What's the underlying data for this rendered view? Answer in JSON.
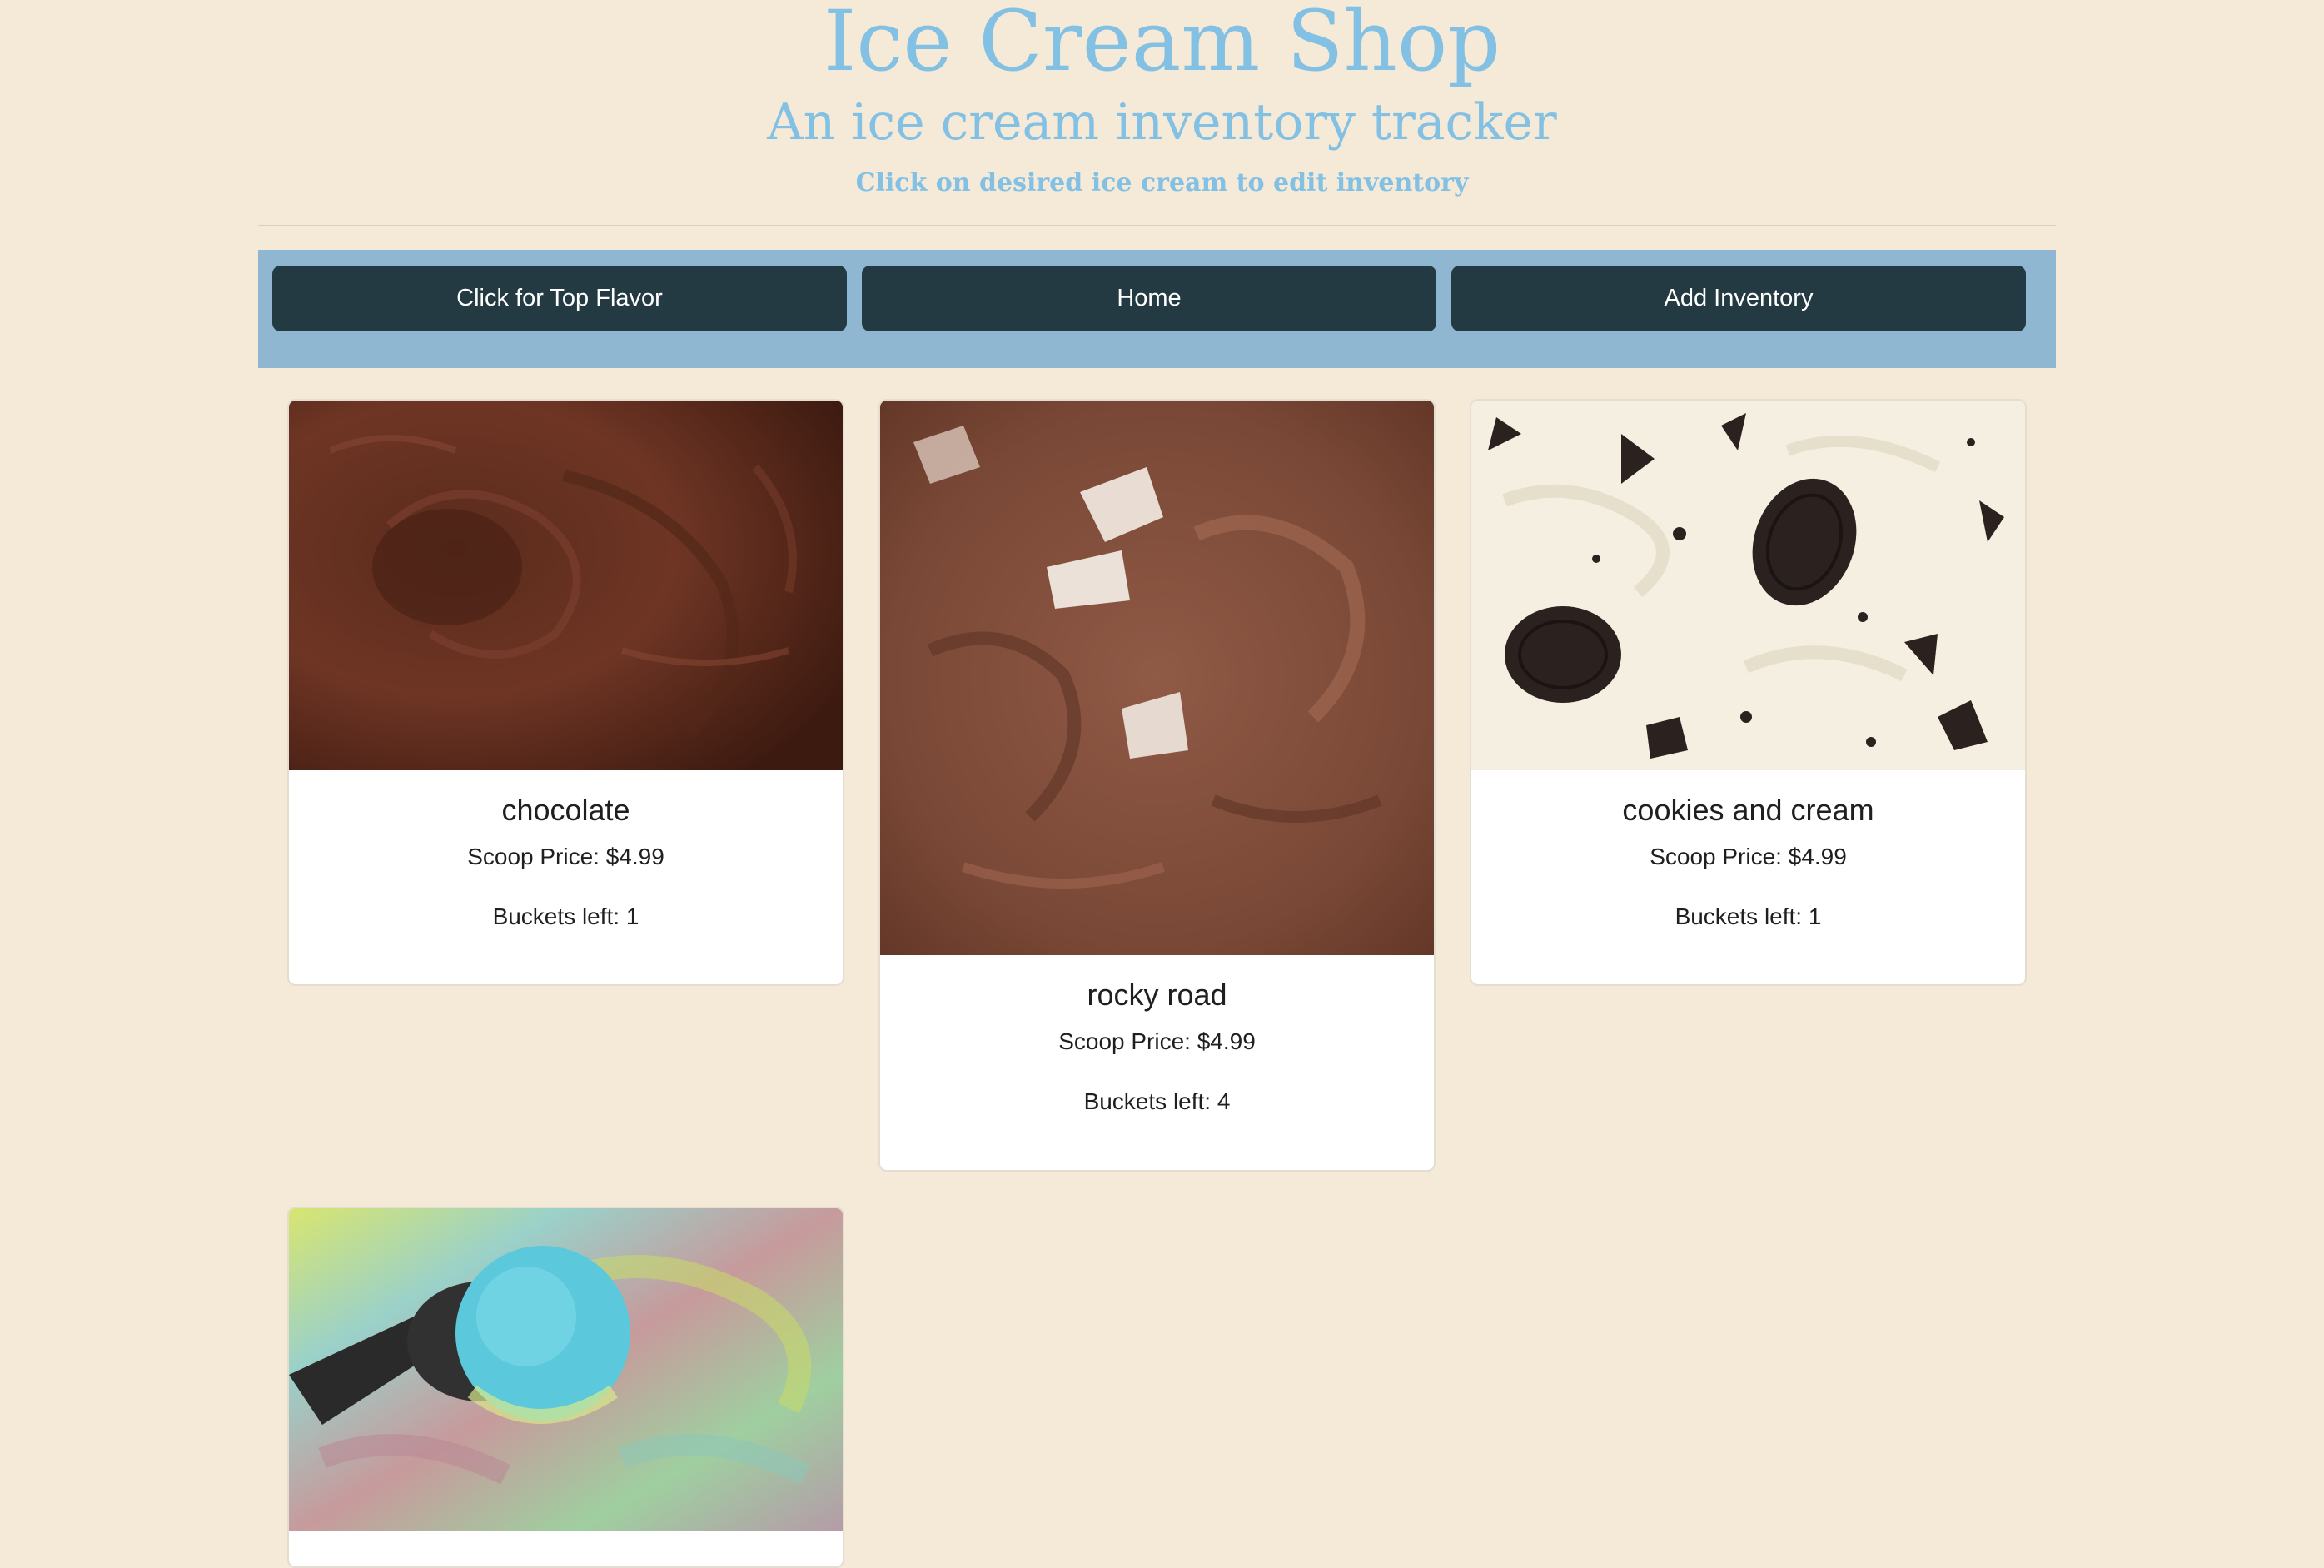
{
  "header": {
    "title": "Ice Cream Shop",
    "subtitle": "An ice cream inventory tracker",
    "instructions": "Click on desired ice cream to edit inventory"
  },
  "nav": {
    "top_flavor_label": "Click for Top Flavor",
    "home_label": "Home",
    "add_inventory_label": "Add Inventory"
  },
  "flavors": [
    {
      "name": "chocolate",
      "price": "Scoop Price: $4.99",
      "buckets": "Buckets left: 1"
    },
    {
      "name": "rocky road",
      "price": "Scoop Price: $4.99",
      "buckets": "Buckets left: 4"
    },
    {
      "name": "cookies and cream",
      "price": "Scoop Price: $4.99",
      "buckets": "Buckets left: 1"
    }
  ],
  "colors": {
    "background": "#f5e9d7",
    "header_text": "#82c0e4",
    "navbar": "#8fb7d2",
    "nav_button": "#233a42"
  }
}
